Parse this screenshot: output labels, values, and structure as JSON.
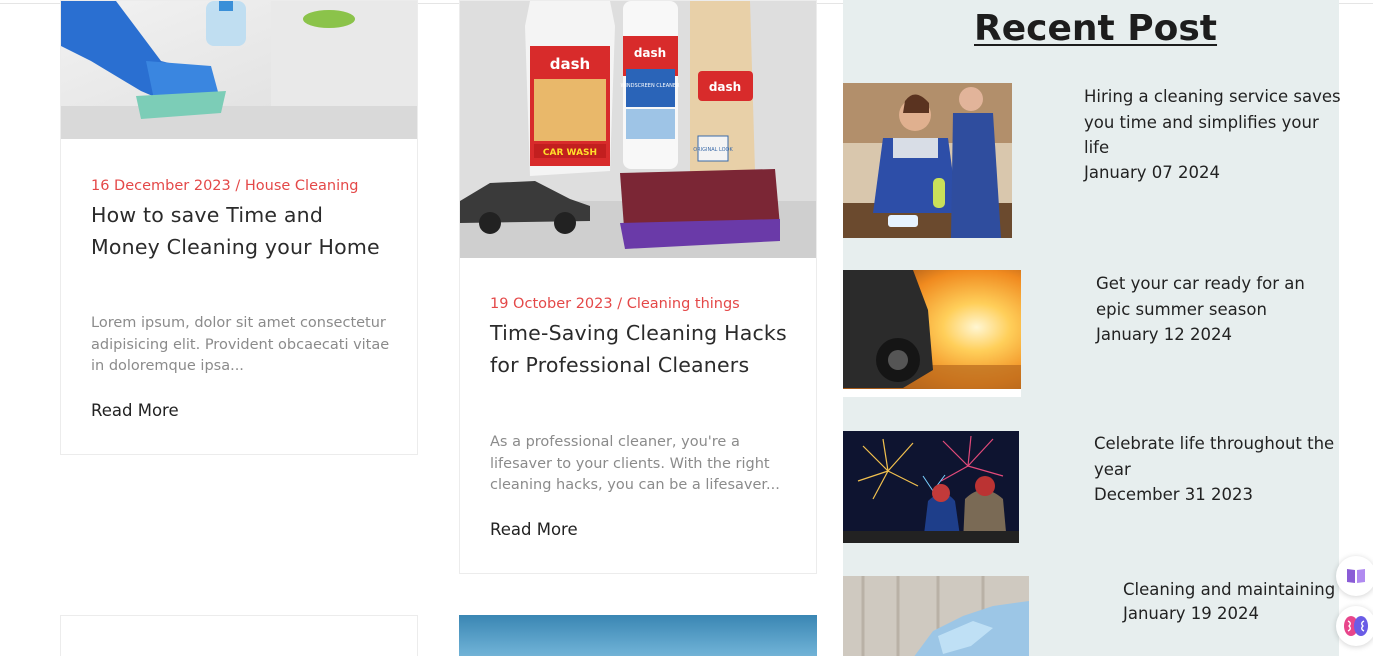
{
  "posts": [
    {
      "meta": "16 December 2023 / House Cleaning",
      "title": "How to save Time and Money Cleaning your Home",
      "excerpt": "Lorem ipsum, dolor sit amet consectetur adipisicing elit. Provident obcaecati vitae in doloremque ipsa...",
      "read_more": "Read More"
    },
    {
      "meta": "19 October 2023 / Cleaning things",
      "title": "Time-Saving Cleaning Hacks for Professional Cleaners",
      "excerpt": "As a professional cleaner, you're a lifesaver to your clients. With the right cleaning hacks, you can be a lifesaver...",
      "read_more": "Read More",
      "product_labels": {
        "brand_1": "dash",
        "brand_2": "dash",
        "brand_3": "dash",
        "product_1": "CAR WASH",
        "product_2": "WINDSCREEN CLEANER",
        "product_3": "ORIGINAL LOOK"
      }
    }
  ],
  "sidebar": {
    "heading": "Recent Post",
    "items": [
      {
        "title": "Hiring a cleaning service saves you time and simplifies your life",
        "date": "January 07 2024"
      },
      {
        "title": "Get your car ready for an epic summer season",
        "date": "January 12 2024"
      },
      {
        "title": "Celebrate life throughout the year",
        "date": "December 31 2023"
      },
      {
        "title": "Cleaning and maintaining",
        "date": "January 19 2024"
      }
    ]
  },
  "floating_buttons": [
    {
      "icon": "book-icon"
    },
    {
      "icon": "brain-icon"
    }
  ],
  "colors": {
    "meta_accent": "#e44848",
    "sidebar_bg": "#e7eeee",
    "excerpt_text": "#8b8b8b"
  }
}
